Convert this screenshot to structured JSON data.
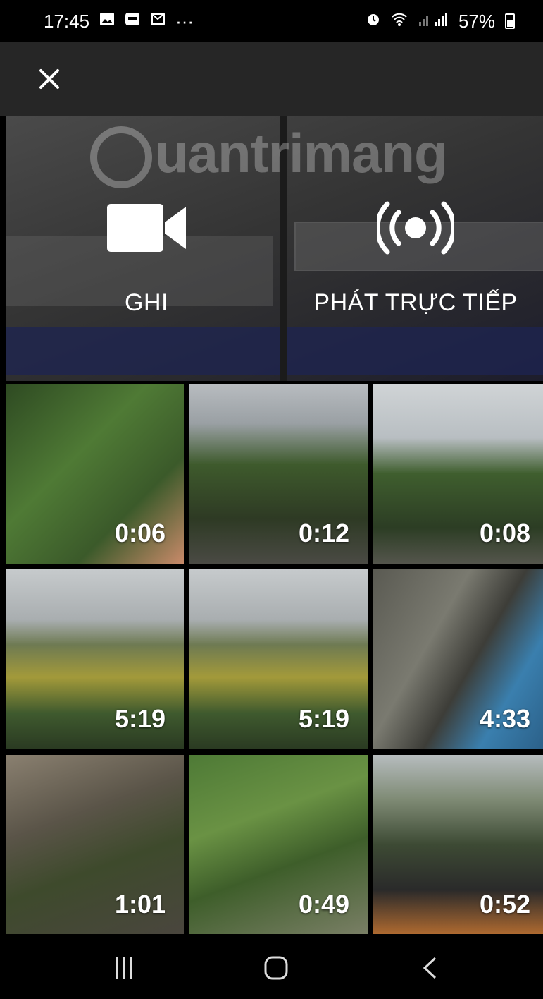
{
  "status_bar": {
    "time": "17:45",
    "notification_icons": [
      "gallery-icon",
      "zalo-icon",
      "message-icon"
    ],
    "more": "···",
    "battery": "57%"
  },
  "create_panel": {
    "record_label": "GHI",
    "live_label": "PHÁT TRỰC TIẾP",
    "watermark": "uantrimang"
  },
  "videos": [
    {
      "duration": "0:06"
    },
    {
      "duration": "0:12"
    },
    {
      "duration": "0:08"
    },
    {
      "duration": "5:19"
    },
    {
      "duration": "5:19"
    },
    {
      "duration": "4:33"
    },
    {
      "duration": "1:01"
    },
    {
      "duration": "0:49"
    },
    {
      "duration": "0:52"
    }
  ]
}
